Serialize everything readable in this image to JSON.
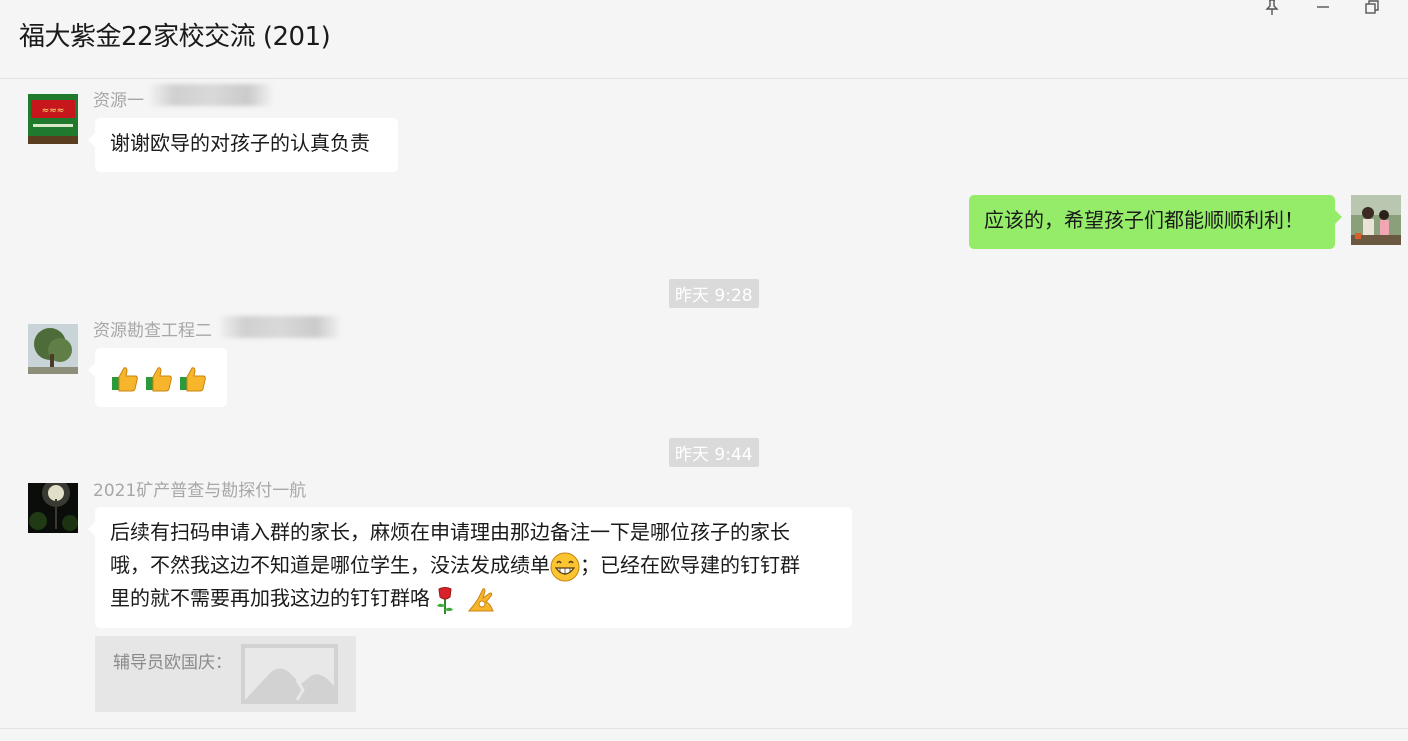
{
  "window": {
    "title": "福大紫金22家校交流 (201)"
  },
  "colors": {
    "background": "#f5f5f5",
    "bubble_incoming": "#ffffff",
    "bubble_outgoing": "#95ec69",
    "timestamp_bg": "#dadada",
    "sender_text": "#a7a7a7"
  },
  "messages": [
    {
      "type": "incoming",
      "sender": "资源一",
      "sender_blurred": true,
      "text": "谢谢欧导的对孩子的认真负责",
      "avatar": "shop-sign-avatar"
    },
    {
      "type": "outgoing",
      "text": "应该的，希望孩子们都能顺顺利利！",
      "avatar": "kids-photo-avatar"
    },
    {
      "type": "timestamp",
      "text": "昨天 9:28"
    },
    {
      "type": "incoming",
      "sender": "资源勘查工程二",
      "sender_blurred": true,
      "emojis": [
        "thumbs-up-emoji",
        "thumbs-up-emoji",
        "thumbs-up-emoji"
      ],
      "avatar": "tree-avatar"
    },
    {
      "type": "timestamp",
      "text": "昨天 9:44"
    },
    {
      "type": "incoming",
      "sender": "2021矿产普查与勘探付一航",
      "lines": [
        "后续有扫码申请入群的家长，麻烦在申请理由那边备注一下是哪位孩子的家长",
        "哦，不然我这边不知道是哪位学生，没法发成绩单",
        "；已经在欧导建的钉钉群",
        "里的就不需要再加我这边的钉钉群咯"
      ],
      "emojis": [
        "grin-emoji",
        "rose-emoji",
        "ok-hand-emoji"
      ],
      "avatar": "night-lamp-avatar"
    },
    {
      "type": "quote",
      "label": "辅导员欧国庆：",
      "image_icon": "image-placeholder-icon"
    }
  ]
}
